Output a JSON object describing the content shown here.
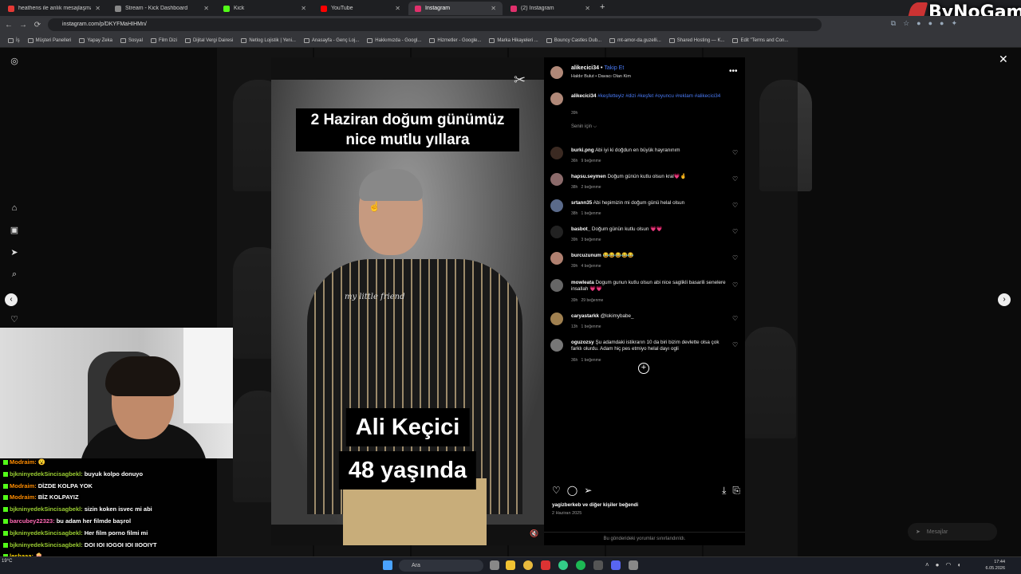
{
  "browser": {
    "tabs": [
      {
        "label": "heathens ile anlık mesajlaşma",
        "color": "#e53935"
      },
      {
        "label": "Stream - Kick Dashboard",
        "color": "#53fc18"
      },
      {
        "label": "Kick",
        "color": "#53fc18"
      },
      {
        "label": "YouTube",
        "color": "#ff0000"
      },
      {
        "label": "Instagram",
        "color": "#e1306c"
      },
      {
        "label": "(2) Instagram",
        "color": "#e1306c"
      }
    ],
    "new_tab": "+",
    "url": "instagram.com/p/DKYFMaHIHMn/",
    "bookmarks": [
      "İş",
      "Müşteri Panelleri",
      "Yapay Zeka",
      "Sosyal",
      "Film Dizi",
      "Dijital Vergi Dairesi",
      "Netlog Lojistik | Yeni...",
      "Anasayfa - Genç Loj...",
      "Hakkımızda - Googl...",
      "Hizmetler - Google...",
      "Marka Hikayeleri ...",
      "Bouncy Castles Dub...",
      "mt-amor-da.guzelli...",
      "Shared Hosting — K...",
      "Edit \"Terms and Con..."
    ]
  },
  "brand_overlay": "ByNoGame",
  "instagram": {
    "close": "✕",
    "prev": "‹",
    "next": "›",
    "video": {
      "caption_top": "2 Haziran doğum günümüz nice mutlu yıllara",
      "caption_name": "Ali Keçici",
      "caption_age": "48 yaşında",
      "shirt_text": "my little friend"
    },
    "post": {
      "username": "alikecici34",
      "follow": "Takip Et",
      "subtitle": "Haldır Bulut • Davacı Olan Kim",
      "caption_user": "alikecici34",
      "caption_tags": "#keşfetteyiz #dizi #keşfet #oyuncu #reklam #alikecici34",
      "caption_time": "39h",
      "for_you": "Senin için ⌵",
      "likes": "yagizberkeb ve diğer kişiler beğendi",
      "date": "2 Haziran 2025",
      "comments_limited": "Bu gönderideki yorumlar sınırlandırıldı."
    },
    "comments": [
      {
        "user": "burki.png",
        "text": "Abi iyi ki doğdun en büyük hayranınım",
        "time": "36h",
        "likes": "9 beğenme",
        "av": "#3b2a22"
      },
      {
        "user": "hapsu.seymen",
        "text": "Doğum günün kutlu olsun kral💗🤞",
        "time": "38h",
        "likes": "2 beğenme",
        "av": "#8b6a6a"
      },
      {
        "user": "srtann35",
        "text": "Abi hepimizin mi doğum günü helal olsun",
        "time": "38h",
        "likes": "1 beğenme",
        "av": "#5a6a8a"
      },
      {
        "user": "basbot_",
        "text": "Doğum günün kutlu olsun 💗💗",
        "time": "39h",
        "likes": "3 beğenme",
        "av": "#222"
      },
      {
        "user": "burcuzunum",
        "text": "😂😂😂😂😂",
        "time": "39h",
        "likes": "4 beğenme",
        "av": "#b08070"
      },
      {
        "user": "mowleata",
        "text": "Dogum gunun kutlu olsun abi nice saglikli basarili senelere insallah 💗💗",
        "time": "39h",
        "likes": "29 beğenme",
        "av": "#666"
      },
      {
        "user": "caryastarkk",
        "text": "@lokimybabe_",
        "time": "13h",
        "likes": "1 beğenme",
        "av": "#a08050"
      },
      {
        "user": "oguzozsy",
        "text": "Şu adamdaki istikrarın 10 da biri bizim devlette olsa çok farklı olurdu. Adam hiç pes etmiyo helal dayı ogli",
        "time": "36h",
        "likes": "1 beğenme",
        "av": "#777"
      }
    ],
    "messages_label": "Mesajlar"
  },
  "chat": [
    {
      "user": "Modraim:",
      "text": "😮",
      "color": "#ff8c00"
    },
    {
      "user": "bjkninyedekSincisagbekl:",
      "text": "buyuk kolpo donuyo",
      "color": "#9acd32"
    },
    {
      "user": "Modraim:",
      "text": "DİZDE KOLPA YOK",
      "color": "#ff8c00"
    },
    {
      "user": "Modraim:",
      "text": "BİZ KOLPAYIZ",
      "color": "#ff8c00"
    },
    {
      "user": "bjkninyedekSincisagbekl:",
      "text": "sizin koken isvec mi abi",
      "color": "#9acd32"
    },
    {
      "user": "barcubey22323:",
      "text": "bu adam her filmde başrol",
      "color": "#ff69b4"
    },
    {
      "user": "bjkninyedekSincisagbekl:",
      "text": "Her film porno filmi mi",
      "color": "#9acd32"
    },
    {
      "user": "bjkninyedekSincisagbekl:",
      "text": "DOI IOI IOGOI IOI IIOOIYT",
      "color": "#9acd32"
    },
    {
      "user": "leshaaa:",
      "text": "🍿",
      "color": "#ffd700"
    },
    {
      "user": "bjkninyedekSincisagbekl:",
      "text": "dogrudru abi",
      "color": "#9acd32"
    }
  ],
  "taskbar": {
    "weather": "19°C",
    "search": "Ara",
    "time": "17:44",
    "date": "6.05.2026"
  }
}
